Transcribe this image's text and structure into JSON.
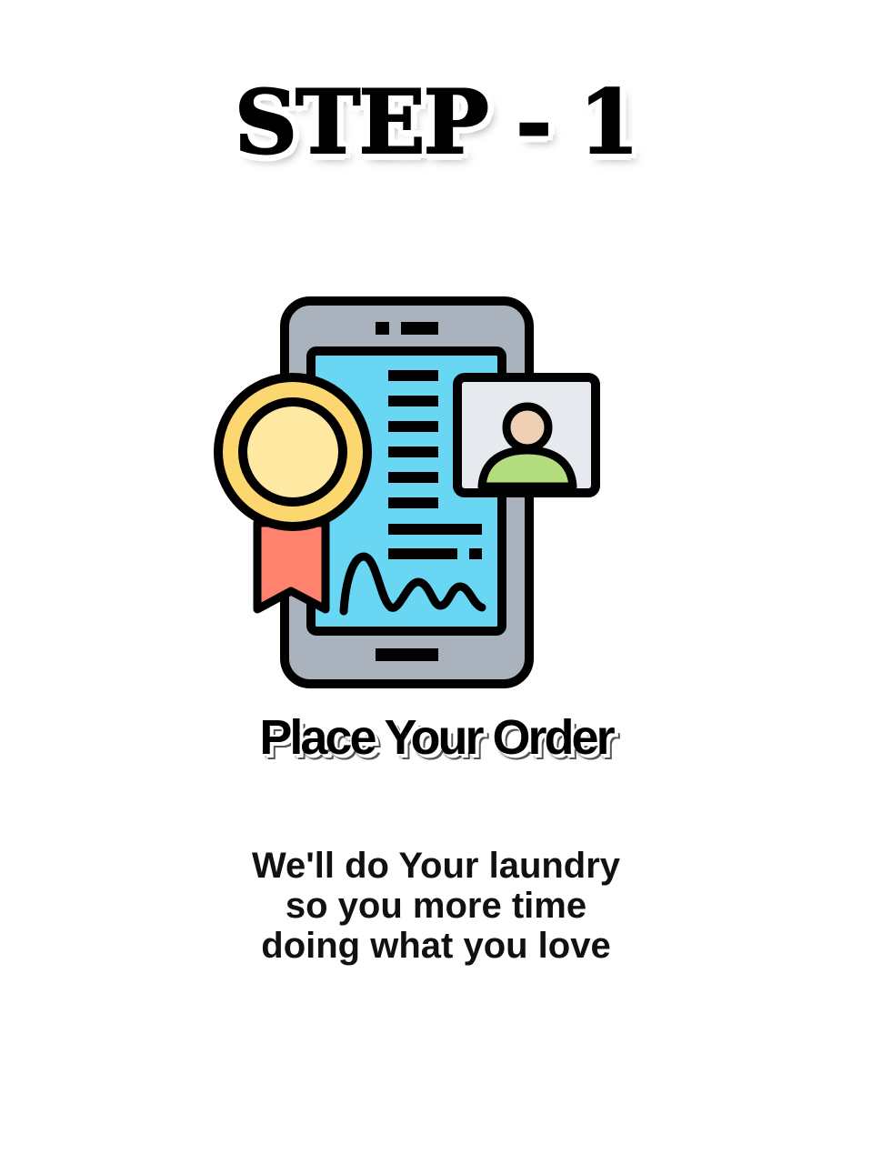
{
  "heading": "STEP - 1",
  "title": "Place Your Order",
  "description": [
    "We'll do Your laundry",
    "so you more time",
    "doing what you love"
  ],
  "icon": "phone-certificate-order-icon",
  "colors": {
    "phone": "#aab2bd",
    "screen": "#69d6f4",
    "medal_ring": "#fcd770",
    "medal_center": "#fee8a2",
    "ribbon": "#ff826e",
    "card": "#e6e9ed",
    "avatar_head": "#f0d0b4",
    "avatar_body": "#b4dd7f"
  }
}
